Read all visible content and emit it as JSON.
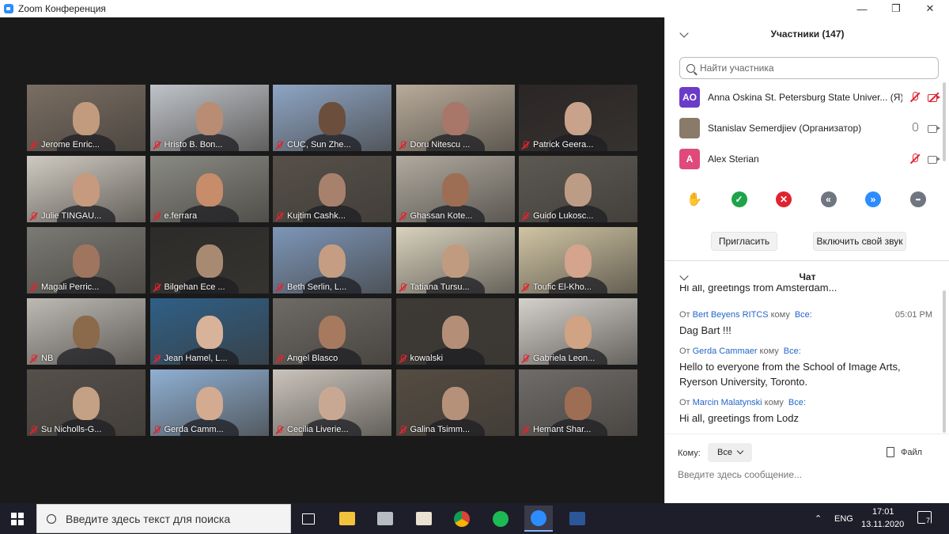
{
  "window": {
    "title": "Zoom Конференция"
  },
  "gallery": {
    "tiles": [
      {
        "name": "Jerome Enric...",
        "bg": "#7a6e63",
        "face": "#c29a7e"
      },
      {
        "name": "Hristo B. Bon...",
        "bg": "#bfc3c9",
        "face": "#b98d73"
      },
      {
        "name": "CUC, Sun Zhe...",
        "bg": "#8ea5c4",
        "face": "#6b4e3b"
      },
      {
        "name": "Doru Nitescu ...",
        "bg": "#b8ab9a",
        "face": "#a8776a"
      },
      {
        "name": "Patrick Geera...",
        "bg": "#2b2626",
        "face": "#c9a28c"
      },
      {
        "name": "Julie TINGAU...",
        "bg": "#cfcac1",
        "face": "#c69a7e"
      },
      {
        "name": "e.ferrara",
        "bg": "#8a8a84",
        "face": "#c78c6a"
      },
      {
        "name": "Kujtim Cashk...",
        "bg": "#575049",
        "face": "#a8816d"
      },
      {
        "name": "Ghassan Kote...",
        "bg": "#b0aa9f",
        "face": "#9d6e54"
      },
      {
        "name": "Guido Lukosc...",
        "bg": "#5c5852",
        "face": "#bd9c86"
      },
      {
        "name": "Magali Perric...",
        "bg": "#7c7a74",
        "face": "#9f7560"
      },
      {
        "name": "Bilgehan Ece ...",
        "bg": "#2c2b29",
        "face": "#a88a73"
      },
      {
        "name": "Beth Serlin, L...",
        "bg": "#7d96b8",
        "face": "#c49d82"
      },
      {
        "name": "Tatiana Tursu...",
        "bg": "#d8d1bd",
        "face": "#c19b80"
      },
      {
        "name": "Toufic El-Kho...",
        "bg": "#d0c4a3",
        "face": "#d4a48c"
      },
      {
        "name": "NB",
        "bg": "#bdbab4",
        "face": "#8a6a4a"
      },
      {
        "name": "Jean Hamel, L...",
        "bg": "#2f5f86",
        "face": "#d9b29a"
      },
      {
        "name": "Angel Blasco",
        "bg": "#6e6a66",
        "face": "#a77a60"
      },
      {
        "name": "kowalski",
        "bg": "#3d3934",
        "face": "#b58e78"
      },
      {
        "name": "Gabriela Leon...",
        "bg": "#d4d0cb",
        "face": "#d0a384"
      },
      {
        "name": "Su Nicholls-G...",
        "bg": "#56504b",
        "face": "#c4a085"
      },
      {
        "name": "Gerda Camm...",
        "bg": "#8fb0d3",
        "face": "#d2ab90"
      },
      {
        "name": "Cecilia Liverie...",
        "bg": "#cac4bc",
        "face": "#c9a893"
      },
      {
        "name": "Galina Tsimm...",
        "bg": "#554c42",
        "face": "#b6917a"
      },
      {
        "name": "Hemant Shar...",
        "bg": "#6f6c69",
        "face": "#9e6e54"
      }
    ]
  },
  "participants": {
    "title": "Участники (147)",
    "search_placeholder": "Найти участника",
    "list": [
      {
        "initials": "AO",
        "avatar_color": "#6a3cc8",
        "name": "Anna Oskina St. Petersburg State Univer... (Я)",
        "mic_muted": true,
        "cam_off": true
      },
      {
        "initials": "",
        "avatar_color": "#8a7a6a",
        "name": "Stanislav Semerdjiev (Организатор)",
        "mic_muted": false,
        "cam_off": false
      },
      {
        "initials": "A",
        "avatar_color": "#e04a7a",
        "name": "Alex Sterian",
        "mic_muted": true,
        "cam_off": false
      }
    ],
    "reactions": [
      {
        "icon": "raise-hand-icon",
        "glyph": "✋",
        "color": "#2d8cff"
      },
      {
        "icon": "yes-icon",
        "glyph": "✓",
        "color": "#1fa34a"
      },
      {
        "icon": "no-icon",
        "glyph": "✕",
        "color": "#e0242f"
      },
      {
        "icon": "slower-icon",
        "glyph": "«",
        "color": "#6f7680"
      },
      {
        "icon": "faster-icon",
        "glyph": "»",
        "color": "#2d8cff"
      },
      {
        "icon": "more-icon",
        "glyph": "•••",
        "color": "#6f7680"
      }
    ],
    "invite_label": "Пригласить",
    "unmute_label": "Включить свой звук"
  },
  "chat": {
    "title": "Чат",
    "partial_line": "Hi all, greetings from Amsterdam... ",
    "messages": [
      {
        "from_prefix": "От",
        "from": "Bert Beyens RITCS",
        "to_prefix": "кому",
        "to": "Все:",
        "time": "05:01 PM",
        "text": "Dag Bart !!!"
      },
      {
        "from_prefix": "От",
        "from": "Gerda Cammaer",
        "to_prefix": "кому",
        "to": "Все:",
        "time": "",
        "text": "Hello to everyone from the School of Image Arts, Ryerson University, Toronto."
      },
      {
        "from_prefix": "От",
        "from": "Marcin Malatynski",
        "to_prefix": "кому",
        "to": "Все:",
        "time": "",
        "text": "Hi all, greetings from Lodz"
      }
    ],
    "to_label": "Кому:",
    "to_value": "Все",
    "file_label": "Файл",
    "input_placeholder": "Введите здесь сообщение..."
  },
  "taskbar": {
    "search_placeholder": "Введите здесь текст для поиска",
    "apps": [
      "task-view-icon",
      "file-explorer-icon",
      "scanner-app-icon",
      "paint-app-icon",
      "chrome-icon",
      "spotify-icon",
      "zoom-icon",
      "word-icon"
    ],
    "language": "ENG",
    "time": "17:01",
    "date": "13.11.2020",
    "notifications": "7"
  }
}
